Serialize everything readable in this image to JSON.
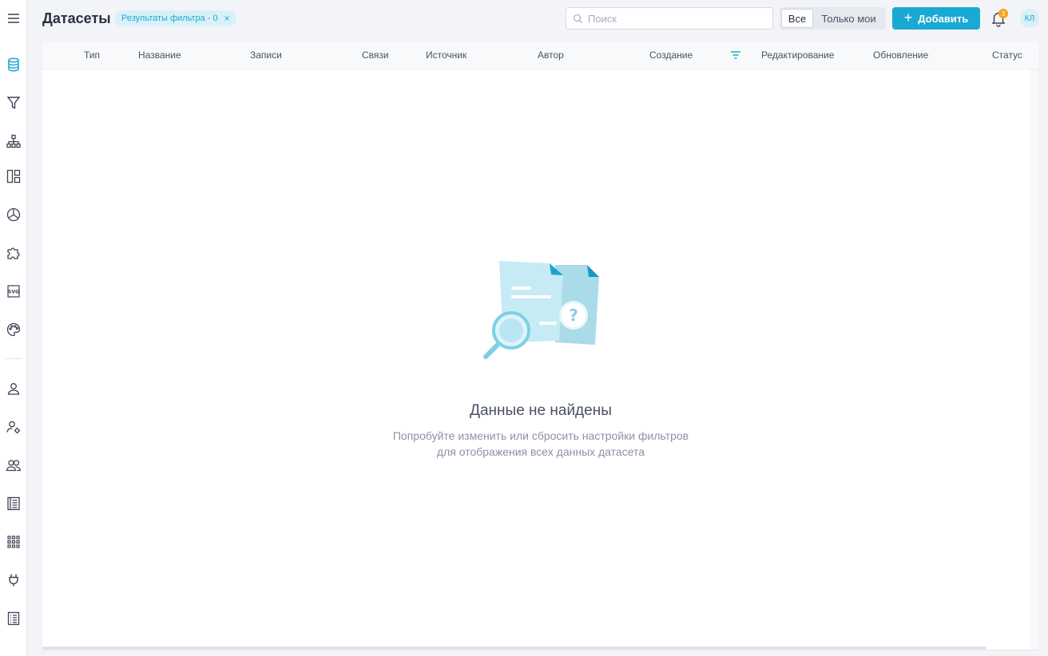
{
  "header": {
    "title": "Датасеты",
    "filter_chip": "Результаты фильтра - 0",
    "filter_chip_close": "×",
    "search_placeholder": "Поиск",
    "segment_all": "Все",
    "segment_mine": "Только мои",
    "add_button": "Добавить",
    "notifications_count": "3",
    "avatar_initials": "КЛ"
  },
  "table": {
    "columns": [
      "Тип",
      "Название",
      "Записи",
      "Связи",
      "Источник",
      "Автор",
      "Создание",
      "Редактирование",
      "Обновление",
      "Статус"
    ]
  },
  "empty_state": {
    "title": "Данные не найдены",
    "line1": "Попробуйте изменить или сбросить настройки фильтров",
    "line2": "для отображения всех данных датасета"
  },
  "sidebar": {
    "items": [
      "database-icon",
      "filter-icon",
      "hierarchy-icon",
      "dashboard-layout-icon",
      "pie-chart-icon",
      "puzzle-icon",
      "svg-icon",
      "palette-icon",
      "user-icon",
      "user-settings-icon",
      "users-group-icon",
      "catalog-icon",
      "apps-grid-icon",
      "plug-icon",
      "log-list-icon"
    ]
  },
  "colors": {
    "accent": "#1aa9d4",
    "badge": "#f4a21c"
  }
}
